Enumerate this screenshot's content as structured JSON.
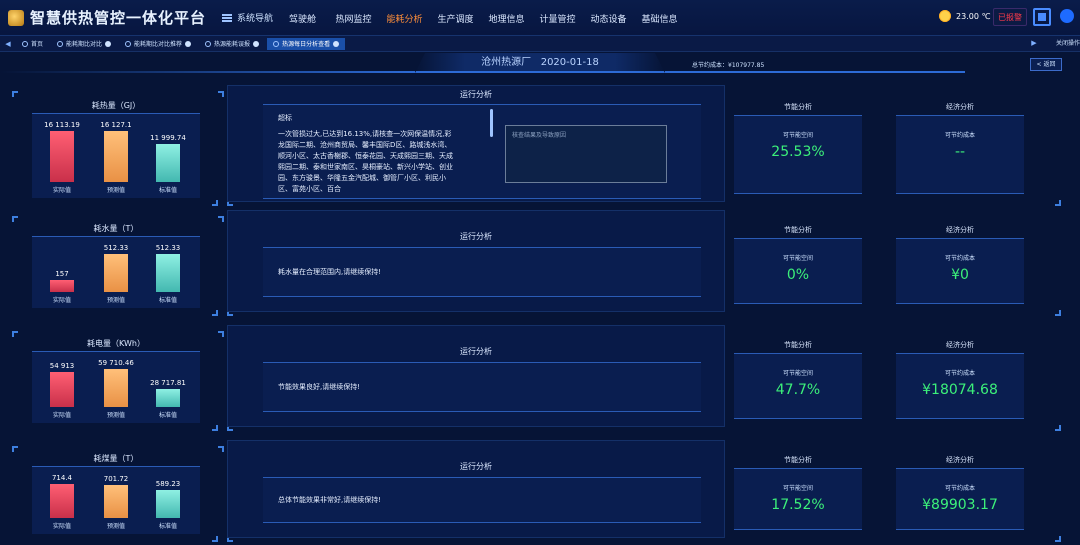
{
  "app": {
    "title": "智慧供热管控一体化平台",
    "system_nav": "系统导航"
  },
  "main_nav": [
    "驾驶舱",
    "热网监控",
    "能耗分析",
    "生产调度",
    "地理信息",
    "计量管控",
    "动态设备",
    "基础信息"
  ],
  "active_nav": "能耗分析",
  "weather": {
    "temperature": "23.00 ℃"
  },
  "alarm_label": "已报警",
  "tabs": [
    {
      "label": "首页",
      "closable": false
    },
    {
      "label": "能耗期比对比",
      "closable": true
    },
    {
      "label": "能耗期比对比推荐",
      "closable": true
    },
    {
      "label": "热源能耗误报",
      "closable": true
    },
    {
      "label": "热源每日分析查看",
      "closable": true,
      "active": true
    }
  ],
  "tab_close_ops": "关闭操作",
  "header": {
    "plant": "沧州热源厂",
    "date": "2020-01-18",
    "total_saving": "总节约成本：¥107977.85",
    "back": "< 返回"
  },
  "rows": [
    {
      "title": "耗热量（GJ）",
      "bars": [
        {
          "label": "实际值",
          "value": 16113.19,
          "display": "16 113.19"
        },
        {
          "label": "预测值",
          "value": 16127.1,
          "display": "16 127.1"
        },
        {
          "label": "标准值",
          "value": 11999.74,
          "display": "11 999.74"
        }
      ],
      "analysis_title": "运行分析",
      "analysis_heading": "超标",
      "analysis_text": "一次管损过大,已达到16.13%,请核查一次网保温情况,彩龙国际二期、沧州商贸局、馨丰国际D区、路城浅水湾、顺河小区、太古香榭郡、恒泰花园、天成熙园三期、天成熙园二期、泰和世家南区、昊桐豪站、新兴小学站、创业园、东方骏景、华隆五金汽配城、御管厂小区、利民小区、富苑小区、百合",
      "reason_placeholder": "核查结果及导致原因",
      "saving_space_title": "节能分析",
      "saving_space_label": "可节能空间",
      "saving_space_value": "25.53%",
      "economic_title": "经济分析",
      "economic_label": "可节约成本",
      "economic_value": "--"
    },
    {
      "title": "耗水量（T）",
      "bars": [
        {
          "label": "实际值",
          "value": 157,
          "display": "157"
        },
        {
          "label": "预测值",
          "value": 512.33,
          "display": "512.33"
        },
        {
          "label": "标准值",
          "value": 512.33,
          "display": "512.33"
        }
      ],
      "analysis_title": "运行分析",
      "analysis_text": "耗水量在合理范围内,请继续保持!",
      "saving_space_title": "节能分析",
      "saving_space_label": "可节能空间",
      "saving_space_value": "0%",
      "economic_title": "经济分析",
      "economic_label": "可节约成本",
      "economic_value": "¥0"
    },
    {
      "title": "耗电量（KWh）",
      "bars": [
        {
          "label": "实际值",
          "value": 54913,
          "display": "54 913"
        },
        {
          "label": "预测值",
          "value": 59710.46,
          "display": "59 710.46"
        },
        {
          "label": "标准值",
          "value": 28717.81,
          "display": "28 717.81"
        }
      ],
      "analysis_title": "运行分析",
      "analysis_text": "节能效果良好,请继续保持!",
      "saving_space_title": "节能分析",
      "saving_space_label": "可节能空间",
      "saving_space_value": "47.7%",
      "economic_title": "经济分析",
      "economic_label": "可节约成本",
      "economic_value": "¥18074.68"
    },
    {
      "title": "耗煤量（T）",
      "bars": [
        {
          "label": "实际值",
          "value": 714.4,
          "display": "714.4"
        },
        {
          "label": "预测值",
          "value": 701.72,
          "display": "701.72"
        },
        {
          "label": "标准值",
          "value": 589.23,
          "display": "589.23"
        }
      ],
      "analysis_title": "运行分析",
      "analysis_text": "总体节能效果非常好,请继续保持!",
      "saving_space_title": "节能分析",
      "saving_space_label": "可节能空间",
      "saving_space_value": "17.52%",
      "economic_title": "经济分析",
      "economic_label": "可节约成本",
      "economic_value": "¥89903.17"
    }
  ]
}
